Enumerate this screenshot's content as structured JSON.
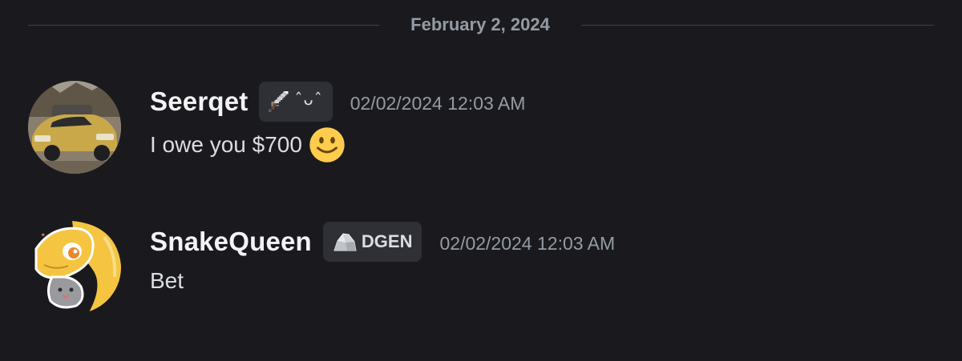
{
  "date_divider": {
    "label": "February 2, 2024"
  },
  "messages": [
    {
      "username": "Seerqet",
      "tag": {
        "icon": "sword-icon",
        "text": "ˆᴗˆ"
      },
      "timestamp": "02/02/2024 12:03 AM",
      "text": "I owe you $700",
      "emoji": "slightly-smiling-face-icon",
      "avatar": "yellow-car-avatar"
    },
    {
      "username": "SnakeQueen",
      "tag": {
        "icon": "rock-icon",
        "text": "DGEN"
      },
      "timestamp": "02/02/2024 12:03 AM",
      "text": "Bet",
      "avatar": "yellow-snake-avatar"
    }
  ],
  "colors": {
    "background": "#1a1a1e",
    "username": "#f2f3f5",
    "muted": "#949ba4",
    "tag_background": "#2e3035",
    "emoji_yellow": "#ffcc4d"
  }
}
